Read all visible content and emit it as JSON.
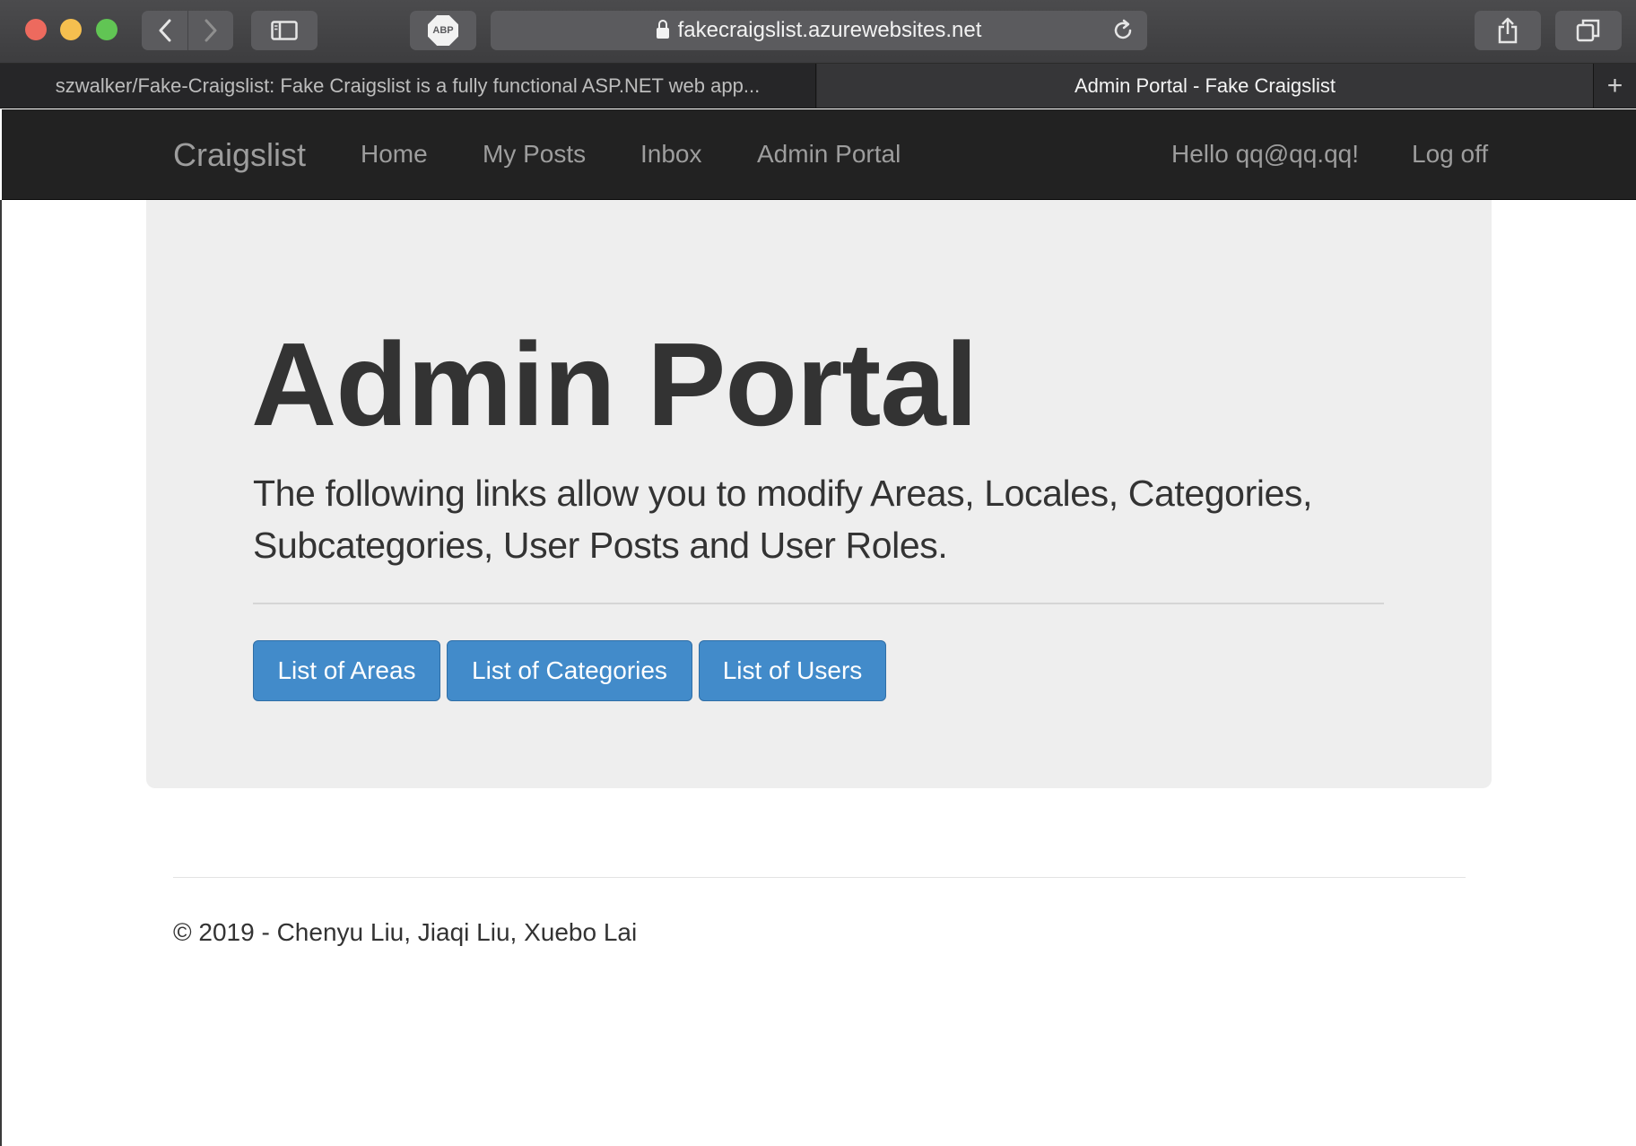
{
  "browser": {
    "url": "fakecraigslist.azurewebsites.net",
    "abp_label": "ABP",
    "tabs": [
      {
        "title": "szwalker/Fake-Craigslist: Fake Craigslist is a fully functional ASP.NET web app...",
        "active": false
      },
      {
        "title": "Admin Portal - Fake Craigslist",
        "active": true
      }
    ],
    "new_tab_glyph": "+",
    "icons": [
      "back-icon",
      "forward-icon",
      "sidebar-icon",
      "lock-icon",
      "reload-icon",
      "share-icon",
      "tabs-overview-icon"
    ]
  },
  "navbar": {
    "brand": "Craigslist",
    "links": [
      "Home",
      "My Posts",
      "Inbox",
      "Admin Portal"
    ],
    "greeting": "Hello qq@qq.qq!",
    "logoff": "Log off"
  },
  "jumbotron": {
    "title": "Admin Portal",
    "lead": "The following links allow you to modify Areas, Locales, Categories, Subcategories, User Posts and User Roles.",
    "buttons": [
      "List of Areas",
      "List of Categories",
      "List of Users"
    ]
  },
  "footer": {
    "text": "© 2019 - Chenyu Liu, Jiaqi Liu, Xuebo Lai"
  },
  "colors": {
    "navbar_bg": "#222222",
    "navbar_text": "#9d9d9d",
    "jumbotron_bg": "#eeeeee",
    "primary_button": "#428bca"
  }
}
